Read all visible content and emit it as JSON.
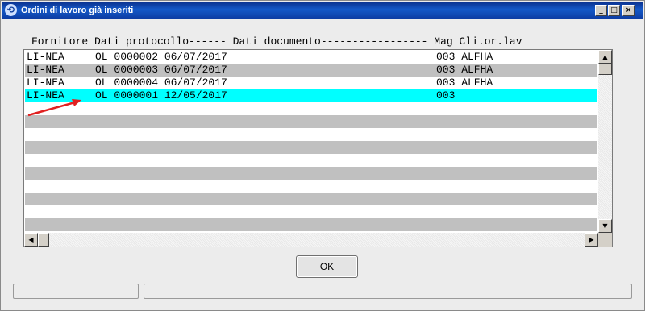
{
  "window": {
    "title": "Ordini di lavoro già inseriti",
    "icon": "app-icon"
  },
  "title_buttons": {
    "minimize": "_",
    "maximize": "□",
    "close": "×"
  },
  "list": {
    "header": "Fornitore Dati protocollo------ Dati documento----------------- Mag Cli.or.lav",
    "rows": [
      {
        "fornitore": "LI-NEA",
        "protocollo": "OL 0000002 06/07/2017",
        "mag_cli": "003 ALFHA",
        "style": "white"
      },
      {
        "fornitore": "LI-NEA",
        "protocollo": "OL 0000003 06/07/2017",
        "mag_cli": "003 ALFHA",
        "style": "grey"
      },
      {
        "fornitore": "LI-NEA",
        "protocollo": "OL 0000004 06/07/2017",
        "mag_cli": "003 ALFHA",
        "style": "white"
      },
      {
        "fornitore": "LI-NEA",
        "protocollo": "OL 0000001 12/05/2017",
        "mag_cli": "003",
        "style": "selected"
      },
      {
        "fornitore": "",
        "protocollo": "",
        "mag_cli": "",
        "style": "white"
      },
      {
        "fornitore": "",
        "protocollo": "",
        "mag_cli": "",
        "style": "grey"
      },
      {
        "fornitore": "",
        "protocollo": "",
        "mag_cli": "",
        "style": "white"
      },
      {
        "fornitore": "",
        "protocollo": "",
        "mag_cli": "",
        "style": "grey"
      },
      {
        "fornitore": "",
        "protocollo": "",
        "mag_cli": "",
        "style": "white"
      },
      {
        "fornitore": "",
        "protocollo": "",
        "mag_cli": "",
        "style": "grey"
      },
      {
        "fornitore": "",
        "protocollo": "",
        "mag_cli": "",
        "style": "white"
      },
      {
        "fornitore": "",
        "protocollo": "",
        "mag_cli": "",
        "style": "grey"
      },
      {
        "fornitore": "",
        "protocollo": "",
        "mag_cli": "",
        "style": "white"
      },
      {
        "fornitore": "",
        "protocollo": "",
        "mag_cli": "",
        "style": "grey"
      }
    ]
  },
  "scroll_arrows": {
    "up": "▲",
    "down": "▼",
    "left": "◀",
    "right": "▶"
  },
  "buttons": {
    "ok": "OK"
  },
  "status": {
    "left": "",
    "right": ""
  },
  "colors": {
    "selected_row": "#00ffff",
    "grey_row": "#c0c0c0",
    "annotation_arrow": "#e02020"
  }
}
